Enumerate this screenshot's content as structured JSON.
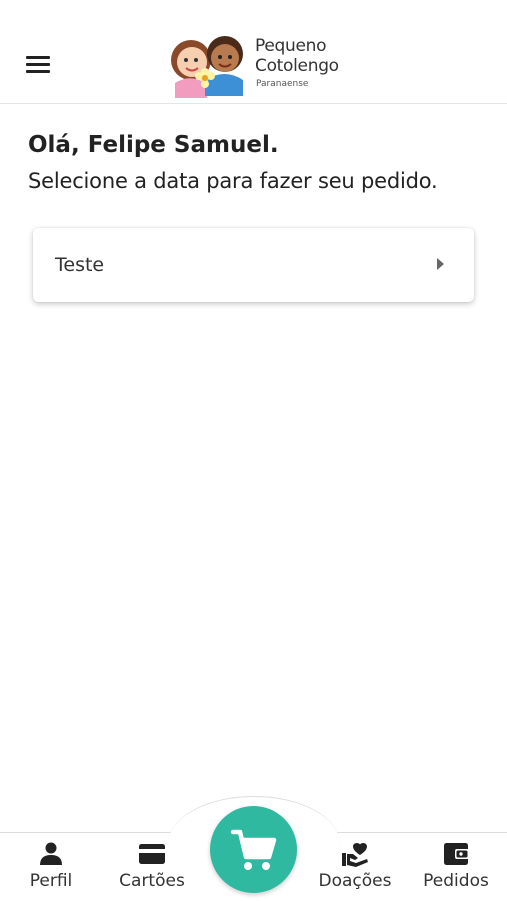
{
  "header": {
    "menu_icon": "hamburger-menu-icon",
    "logo": {
      "line1": "Pequeno",
      "line2": "Cotolengo",
      "line3": "Paranaense"
    }
  },
  "main": {
    "greeting": "Olá, Felipe Samuel.",
    "subtitle": "Selecione a data para fazer seu pedido.",
    "dates": [
      {
        "label": "Teste",
        "icon": "chevron-right-icon"
      }
    ]
  },
  "bottom_nav": {
    "items": [
      {
        "label": "Perfil",
        "icon": "person-icon"
      },
      {
        "label": "Cartões",
        "icon": "credit-card-icon"
      },
      {
        "label": "Doações",
        "icon": "donation-heart-icon"
      },
      {
        "label": "Pedidos",
        "icon": "wallet-icon"
      }
    ],
    "cart_icon": "shopping-cart-icon",
    "accent_color": "#2fb9a0"
  }
}
